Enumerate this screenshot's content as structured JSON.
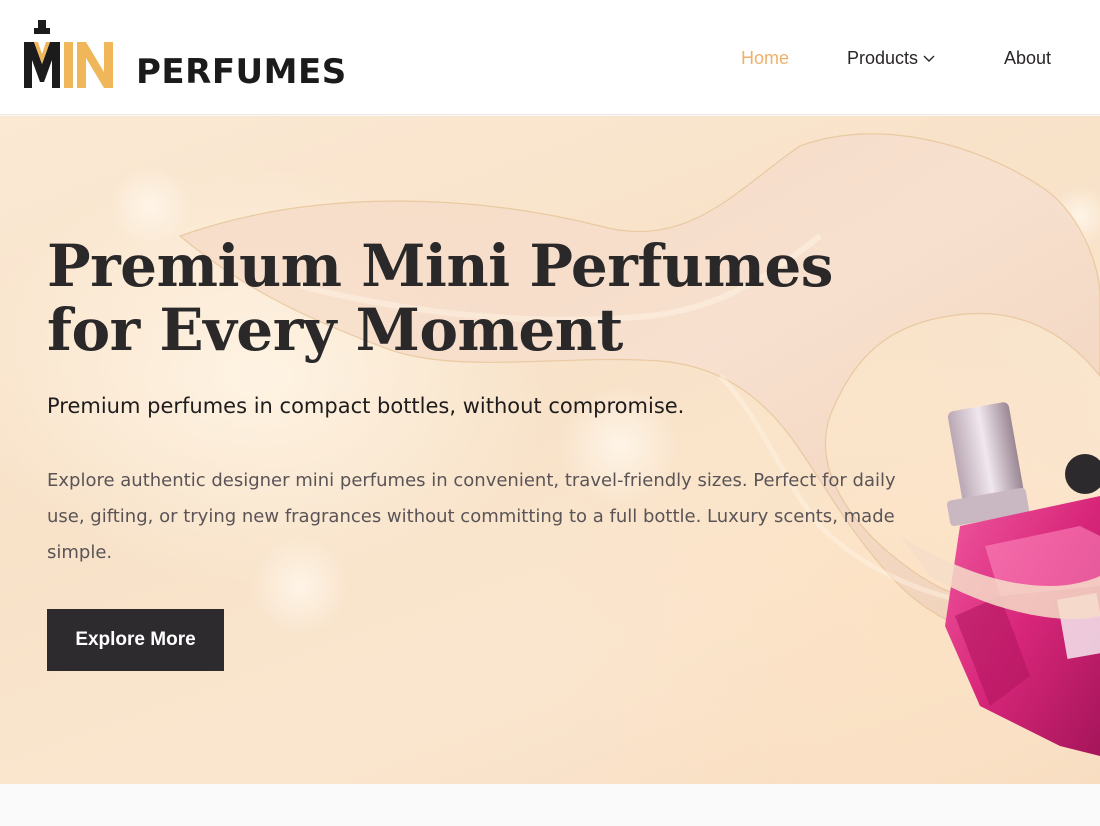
{
  "brand": {
    "mark_text": "MN",
    "name": "PERFUMES",
    "gold": "#f0b75a",
    "dark": "#1b1b1b"
  },
  "nav": {
    "items": [
      {
        "label": "Home",
        "active": true
      },
      {
        "label": "Products",
        "has_dropdown": true,
        "icon": "chevron-down-icon"
      },
      {
        "label": "About"
      }
    ],
    "active_color": "#f0b06a"
  },
  "hero": {
    "title_line1": "Premium Mini Perfumes",
    "title_line2": "for Every Moment",
    "subtitle": "Premium perfumes in compact bottles, without compromise.",
    "description": "Explore authentic designer mini perfumes in convenient, travel-friendly sizes. Perfect for daily use, gifting, or trying new fragrances without committing to a full bottle. Luxury scents, made simple.",
    "cta_label": "Explore More",
    "cta_color": "#2e2b2e",
    "background_color": "#f9e4cb",
    "bottle_color": "#d8267a"
  }
}
